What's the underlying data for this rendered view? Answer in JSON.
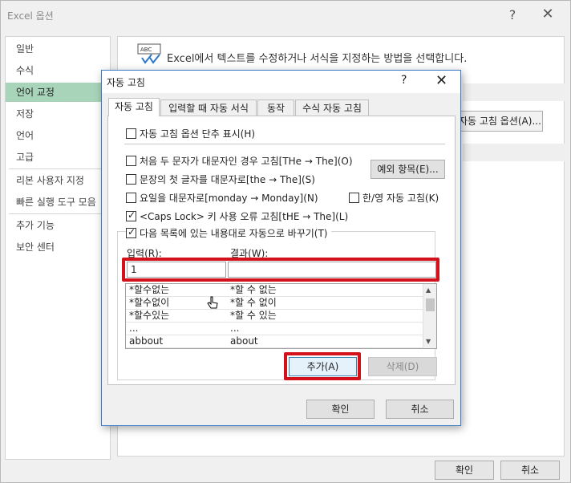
{
  "outer": {
    "title": "Excel 옵션",
    "help": "?",
    "close": "✕",
    "sidebar": [
      {
        "label": "일반"
      },
      {
        "label": "수식"
      },
      {
        "label": "언어 교정",
        "active": true
      },
      {
        "label": "저장"
      },
      {
        "label": "언어"
      },
      {
        "label": "고급"
      },
      {
        "label": "리본 사용자 지정"
      },
      {
        "label": "빠른 실행 도구 모음"
      },
      {
        "label": "추가 기능"
      },
      {
        "label": "보안 센터"
      }
    ],
    "main_description": "Excel에서 텍스트를 수정하거나 서식을 지정하는 방법을 선택합니다.",
    "autocorrect_options_button": "자동 고침 옵션(A)...",
    "ok": "확인",
    "cancel": "취소"
  },
  "dialog": {
    "title": "자동 고침",
    "help": "?",
    "close": "✕",
    "tabs": [
      {
        "label": "자동 고침",
        "active": true
      },
      {
        "label": "입력할 때 자동 서식"
      },
      {
        "label": "동작"
      },
      {
        "label": "수식 자동 고침"
      }
    ],
    "show_buttons": {
      "label": "자동 고침 옵션 단추 표시(H)",
      "checked": false
    },
    "two_initial_caps": {
      "label": "처음 두 문자가 대문자인 경우 고침[THe → The](O)",
      "checked": false
    },
    "capitalize_sentences": {
      "label": "문장의 첫 글자를 대문자로[the → The](S)",
      "checked": false
    },
    "capitalize_days": {
      "label": "요일을 대문자로[monday → Monday](N)",
      "checked": false
    },
    "korean_english": {
      "label": "한/영 자동 고침(K)",
      "checked": false
    },
    "caps_lock": {
      "label": "<Caps Lock> 키 사용 오류 고침[tHE → The](L)",
      "checked": true
    },
    "replace_as_type": {
      "label": "다음 목록에 있는 내용대로 자동으로 바꾸기(T)",
      "checked": true
    },
    "exceptions_button": "예외 항목(E)...",
    "replace_label": "입력(R):",
    "with_label": "결과(W):",
    "replace_value": "1",
    "with_value": "",
    "list": [
      {
        "replace": "*할수없는",
        "with": "*할 수 없는"
      },
      {
        "replace": "*할수없이",
        "with": "*할 수 없이"
      },
      {
        "replace": "*할수있는",
        "with": "*할 수 있는"
      },
      {
        "replace": "...",
        "with": "..."
      },
      {
        "replace": "abbout",
        "with": "about"
      }
    ],
    "add_button": "추가(A)",
    "delete_button": "삭제(D)",
    "ok": "확인",
    "cancel": "취소"
  },
  "colors": {
    "highlight_red": "#d4101a",
    "sidebar_active": "#a8d5ba",
    "dialog_border": "#3a7bc8"
  }
}
